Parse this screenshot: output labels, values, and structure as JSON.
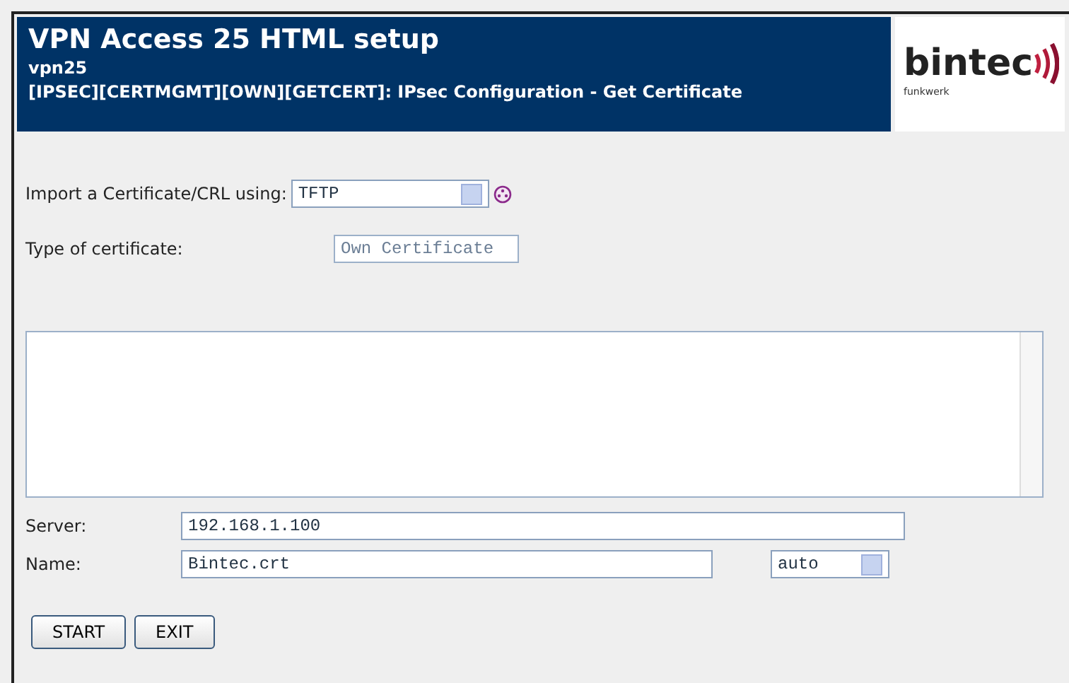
{
  "header": {
    "title": "VPN Access 25 HTML setup",
    "device": "vpn25",
    "path": "[IPSEC][CERTMGMT][OWN][GETCERT]: IPsec Configuration - Get Certificate"
  },
  "logo": {
    "brand": "bintec",
    "sub": "funkwerk"
  },
  "import": {
    "label": "Import a Certificate/CRL using:",
    "value": "TFTP"
  },
  "cert_type": {
    "label": "Type of certificate:",
    "value": "Own Certificate"
  },
  "server": {
    "label": "Server:",
    "value": "192.168.1.100"
  },
  "name": {
    "label": "Name:",
    "value": "Bintec.crt",
    "mode": "auto"
  },
  "buttons": [
    "START",
    "EXIT"
  ]
}
